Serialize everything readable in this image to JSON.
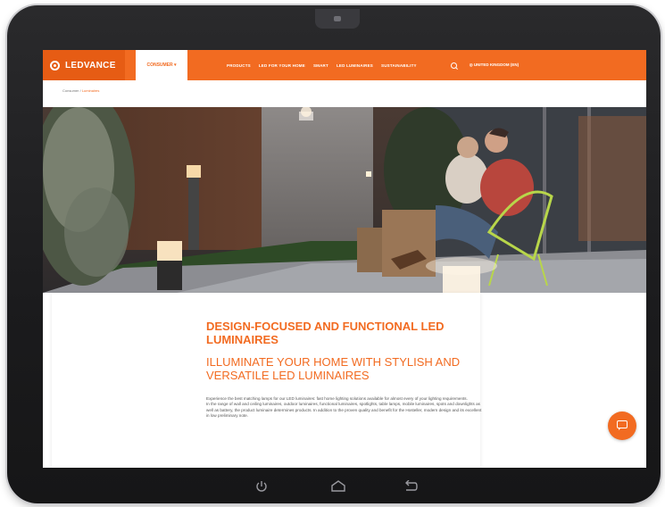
{
  "navbar": {
    "brand": "LEDVANCE",
    "home_tab": "CONSUMER",
    "items": [
      {
        "label": "PRODUCTS"
      },
      {
        "label": "LED FOR YOUR HOME"
      },
      {
        "label": "SMART"
      },
      {
        "label": "LED LUMINAIRES"
      },
      {
        "label": "SUSTAINABILITY"
      }
    ],
    "region": "UNITED KINGDOM (EN)"
  },
  "breadcrumb": {
    "items": [
      "Consumer",
      "Luminaires"
    ]
  },
  "content": {
    "headline": "DESIGN-FOCUSED AND FUNCTIONAL LED LUMINAIRES",
    "subheadline": "ILLUMINATE YOUR HOME WITH STYLISH AND VERSATILE LED LUMINAIRES",
    "paragraphs": [
      "Experience the best matching lamps for our LED luminaires: fast home lighting solutions available for almost every of your lighting requirements.",
      "In the range of wall and ceiling luminaires, outdoor luminaires, functional luminaires, spotlights, table lamps, mobile luminaires, spots and downlights as well as battery, the product luminaire determines products. In addition to the proven quality and benefit for the Hosteller, modern design and its excellent in low preliminary note."
    ]
  },
  "colors": {
    "accent": "#f26b21",
    "brand_dark": "#e65c14"
  },
  "icons": {
    "search": "search-icon",
    "chat": "chat-icon",
    "power": "power-icon",
    "home": "home-icon",
    "back": "back-icon"
  }
}
